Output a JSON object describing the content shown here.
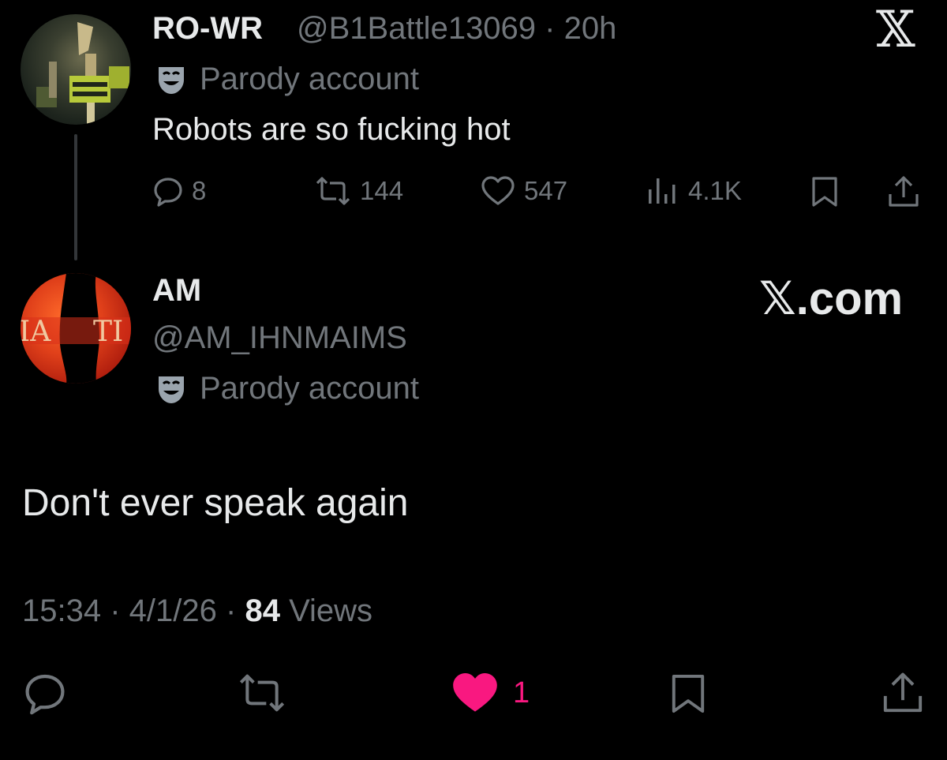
{
  "parent_tweet": {
    "display_name": "RO-WR",
    "handle_time": "@B1Battle13069 · 20h",
    "badge": "Parody account",
    "text": "Robots are so fucking hot",
    "replies": "8",
    "reposts": "144",
    "likes": "547",
    "views": "4.1K"
  },
  "header": {
    "logo": "𝕏"
  },
  "reply_tweet": {
    "display_name": "AM",
    "handle": "@AM_IHNMAIMS",
    "badge": "Parody account",
    "site": "𝕏.com",
    "text": "Don't ever speak again",
    "time": "15:34",
    "date": "4/1/26",
    "views_count": "84",
    "views_label": "Views",
    "likes": "1"
  },
  "colors": {
    "background": "#000000",
    "text_primary": "#e7e9ea",
    "text_secondary": "#71767b",
    "like_active": "#f91880"
  },
  "icons": {
    "parody": "theater-mask-icon",
    "reply": "speech-bubble-icon",
    "repost": "repost-arrows-icon",
    "like": "heart-icon",
    "views": "bar-chart-icon",
    "bookmark": "bookmark-icon",
    "share": "share-upload-icon"
  }
}
